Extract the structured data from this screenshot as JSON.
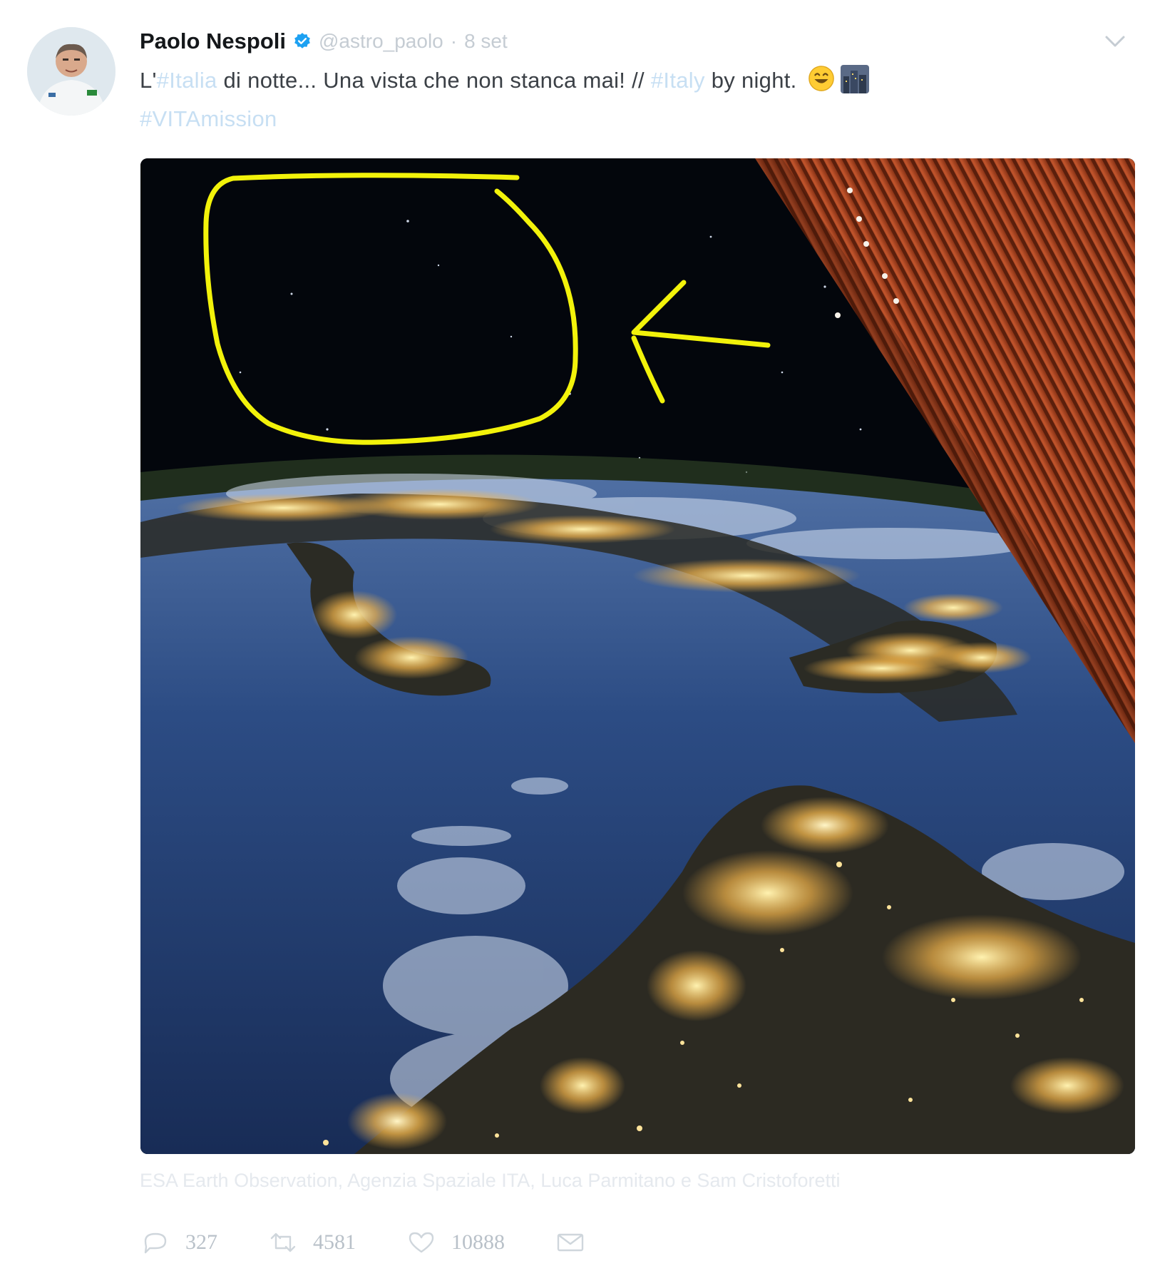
{
  "colors": {
    "annotation": "#f2f20a",
    "hashtag": "#c7dff3",
    "muted": "#c5ccd3",
    "verified": "#1da1f2"
  },
  "icons": {
    "verified": "verified-badge-icon",
    "caret": "chevron-down-icon",
    "reply": "reply-icon",
    "retweet": "retweet-icon",
    "like": "heart-icon",
    "message": "envelope-icon"
  },
  "tweet": {
    "author_name": "Paolo Nespoli",
    "handle": "@astro_paolo",
    "separator": "·",
    "date": "8 set",
    "text": {
      "part1": "L'",
      "hashtag1": "#Italia",
      "part2": " di notte... Una vista che non stanca mai! // ",
      "hashtag2": "#Italy",
      "part3": " by night. ",
      "hashtag3": "#VITAmission"
    },
    "caption": "ESA Earth Observation, Agenzia Spaziale ITA, Luca Parmitano e Sam Cristoforetti",
    "actions": {
      "reply_count": "327",
      "retweet_count": "4581",
      "like_count": "10888"
    }
  }
}
